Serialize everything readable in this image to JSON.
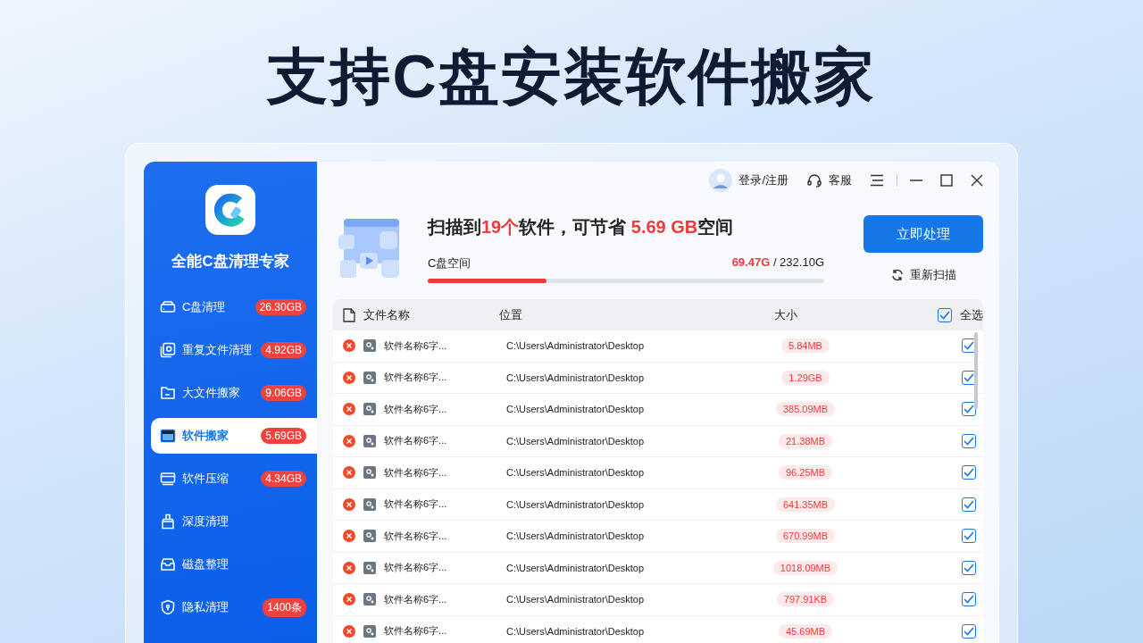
{
  "banner": {
    "title": "支持C盘安装软件搬家"
  },
  "app": {
    "name": "全能C盘清理专家"
  },
  "sidebar": {
    "items": [
      {
        "kind": "drive",
        "label": "C盘清理",
        "badge": "26.30GB",
        "selected": false
      },
      {
        "kind": "duplicate",
        "label": "重复文件清理",
        "badge": "4.92GB",
        "selected": false
      },
      {
        "kind": "folder",
        "label": "大文件搬家",
        "badge": "9.06GB",
        "selected": false
      },
      {
        "kind": "window",
        "label": "软件搬家",
        "badge": "5.69GB",
        "selected": true
      },
      {
        "kind": "compress",
        "label": "软件压缩",
        "badge": "4.34GB",
        "selected": false
      },
      {
        "kind": "brush",
        "label": "深度清理",
        "selected": false
      },
      {
        "kind": "tray",
        "label": "磁盘整理",
        "selected": false
      },
      {
        "kind": "shield",
        "label": "隐私清理",
        "badge": "1400条",
        "selected": false
      }
    ]
  },
  "topbar": {
    "login": "登录/注册",
    "support": "客服"
  },
  "summary": {
    "parts": [
      {
        "text": "扫描到",
        "highlight": false
      },
      {
        "text": "19个",
        "highlight": true
      },
      {
        "text": "软件，可节省 ",
        "highlight": false
      },
      {
        "text": "5.69 GB",
        "highlight": true
      },
      {
        "text": "空间",
        "highlight": false
      }
    ],
    "usage_label": "C盘空间",
    "used": "69.47G",
    "total": " / 232.10G",
    "level": 0.3,
    "action": "立即处理",
    "rescan": "重新扫描"
  },
  "table": {
    "columns": [
      "文件名称",
      "位置",
      "大小"
    ],
    "select_all": {
      "label": "全选",
      "checked": true
    },
    "rows": [
      {
        "name": "软件名称6字...",
        "path": "C:\\Users\\Administrator\\Desktop",
        "size": "5.84MB",
        "checked": true
      },
      {
        "name": "软件名称6字...",
        "path": "C:\\Users\\Administrator\\Desktop",
        "size": "1.29GB",
        "checked": true
      },
      {
        "name": "软件名称6字...",
        "path": "C:\\Users\\Administrator\\Desktop",
        "size": "385.09MB",
        "checked": true
      },
      {
        "name": "软件名称6字...",
        "path": "C:\\Users\\Administrator\\Desktop",
        "size": "21.38MB",
        "checked": true
      },
      {
        "name": "软件名称6字...",
        "path": "C:\\Users\\Administrator\\Desktop",
        "size": "96.25MB",
        "checked": true
      },
      {
        "name": "软件名称6字...",
        "path": "C:\\Users\\Administrator\\Desktop",
        "size": "641.35MB",
        "checked": true
      },
      {
        "name": "软件名称6字...",
        "path": "C:\\Users\\Administrator\\Desktop",
        "size": "670.99MB",
        "checked": true
      },
      {
        "name": "软件名称6字...",
        "path": "C:\\Users\\Administrator\\Desktop",
        "size": "1018.09MB",
        "checked": true
      },
      {
        "name": "软件名称6字...",
        "path": "C:\\Users\\Administrator\\Desktop",
        "size": "797.91KB",
        "checked": true
      },
      {
        "name": "软件名称6字...",
        "path": "C:\\Users\\Administrator\\Desktop",
        "size": "45.69MB",
        "checked": true
      }
    ]
  }
}
